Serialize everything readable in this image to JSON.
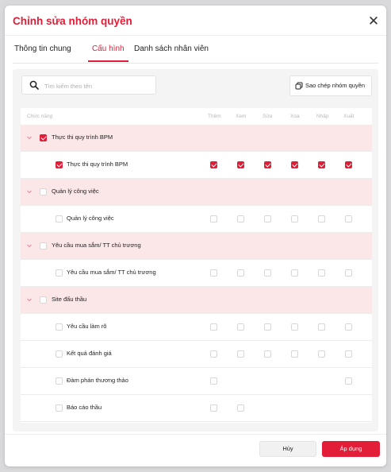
{
  "title": "Chỉnh sửa nhóm quyền",
  "tabs": [
    {
      "label": "Thông tin chung",
      "active": false
    },
    {
      "label": "Cấu hình",
      "active": true
    },
    {
      "label": "Danh sách nhân viên",
      "active": false
    }
  ],
  "search": {
    "placeholder": "Tìm kiếm theo tên",
    "value": ""
  },
  "copy_button": "Sao chép nhóm quyền",
  "table": {
    "headers": [
      "Chức năng",
      "Thêm",
      "Xem",
      "Sửa",
      "Xóa",
      "Nhập",
      "Xuất"
    ],
    "rows": [
      {
        "type": "group",
        "label": "Thực thi quy trình BPM",
        "checked": true
      },
      {
        "type": "item",
        "label": "Thực thi quy trình BPM",
        "checked": true,
        "perms": [
          true,
          true,
          true,
          true,
          true,
          true
        ]
      },
      {
        "type": "group",
        "label": "Quản lý công việc",
        "checked": false
      },
      {
        "type": "item",
        "label": "Quản lý công việc",
        "checked": false,
        "perms": [
          false,
          false,
          false,
          false,
          false,
          false
        ]
      },
      {
        "type": "group",
        "label": "Yêu cầu mua sắm/ TT chủ trương",
        "checked": false
      },
      {
        "type": "item",
        "label": "Yêu cầu mua sắm/ TT chủ trương",
        "checked": false,
        "perms": [
          false,
          false,
          false,
          false,
          false,
          false
        ]
      },
      {
        "type": "group",
        "label": "Site đấu thầu",
        "checked": false
      },
      {
        "type": "item",
        "label": "Yêu cầu làm rõ",
        "checked": false,
        "perms": [
          false,
          false,
          false,
          false,
          false,
          false
        ]
      },
      {
        "type": "item",
        "label": "Kết quả đánh giá",
        "checked": false,
        "perms": [
          false,
          false,
          false,
          false,
          false,
          false
        ]
      },
      {
        "type": "item",
        "label": "Đàm phán thương thảo",
        "checked": false,
        "perms": [
          false,
          null,
          null,
          null,
          null,
          false
        ]
      },
      {
        "type": "item",
        "label": "Báo cáo thầu",
        "checked": false,
        "perms": [
          false,
          false,
          null,
          null,
          null,
          null
        ]
      }
    ]
  },
  "footer": {
    "cancel": "Hủy",
    "apply": "Áp dụng"
  },
  "colors": {
    "accent": "#e11d37",
    "group_row_bg": "#fbe6e8"
  }
}
